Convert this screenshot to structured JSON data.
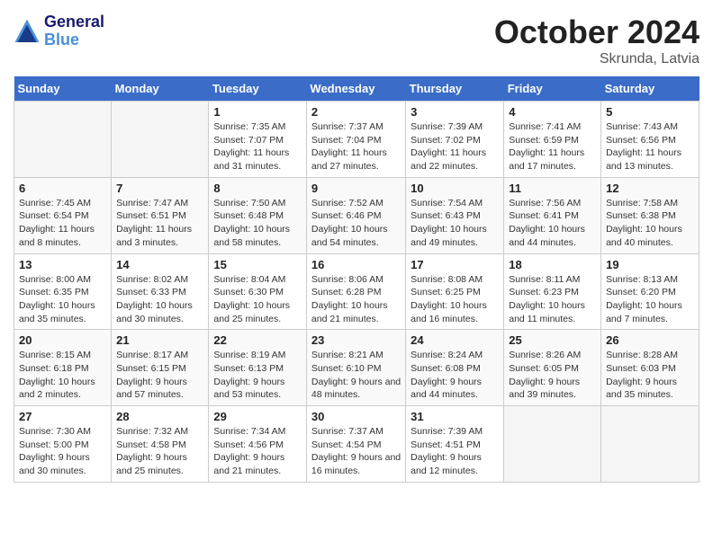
{
  "header": {
    "logo_line1": "General",
    "logo_line2": "Blue",
    "month": "October 2024",
    "location": "Skrunda, Latvia"
  },
  "weekdays": [
    "Sunday",
    "Monday",
    "Tuesday",
    "Wednesday",
    "Thursday",
    "Friday",
    "Saturday"
  ],
  "weeks": [
    [
      {
        "day": "",
        "info": ""
      },
      {
        "day": "",
        "info": ""
      },
      {
        "day": "1",
        "info": "Sunrise: 7:35 AM\nSunset: 7:07 PM\nDaylight: 11 hours and 31 minutes."
      },
      {
        "day": "2",
        "info": "Sunrise: 7:37 AM\nSunset: 7:04 PM\nDaylight: 11 hours and 27 minutes."
      },
      {
        "day": "3",
        "info": "Sunrise: 7:39 AM\nSunset: 7:02 PM\nDaylight: 11 hours and 22 minutes."
      },
      {
        "day": "4",
        "info": "Sunrise: 7:41 AM\nSunset: 6:59 PM\nDaylight: 11 hours and 17 minutes."
      },
      {
        "day": "5",
        "info": "Sunrise: 7:43 AM\nSunset: 6:56 PM\nDaylight: 11 hours and 13 minutes."
      }
    ],
    [
      {
        "day": "6",
        "info": "Sunrise: 7:45 AM\nSunset: 6:54 PM\nDaylight: 11 hours and 8 minutes."
      },
      {
        "day": "7",
        "info": "Sunrise: 7:47 AM\nSunset: 6:51 PM\nDaylight: 11 hours and 3 minutes."
      },
      {
        "day": "8",
        "info": "Sunrise: 7:50 AM\nSunset: 6:48 PM\nDaylight: 10 hours and 58 minutes."
      },
      {
        "day": "9",
        "info": "Sunrise: 7:52 AM\nSunset: 6:46 PM\nDaylight: 10 hours and 54 minutes."
      },
      {
        "day": "10",
        "info": "Sunrise: 7:54 AM\nSunset: 6:43 PM\nDaylight: 10 hours and 49 minutes."
      },
      {
        "day": "11",
        "info": "Sunrise: 7:56 AM\nSunset: 6:41 PM\nDaylight: 10 hours and 44 minutes."
      },
      {
        "day": "12",
        "info": "Sunrise: 7:58 AM\nSunset: 6:38 PM\nDaylight: 10 hours and 40 minutes."
      }
    ],
    [
      {
        "day": "13",
        "info": "Sunrise: 8:00 AM\nSunset: 6:35 PM\nDaylight: 10 hours and 35 minutes."
      },
      {
        "day": "14",
        "info": "Sunrise: 8:02 AM\nSunset: 6:33 PM\nDaylight: 10 hours and 30 minutes."
      },
      {
        "day": "15",
        "info": "Sunrise: 8:04 AM\nSunset: 6:30 PM\nDaylight: 10 hours and 25 minutes."
      },
      {
        "day": "16",
        "info": "Sunrise: 8:06 AM\nSunset: 6:28 PM\nDaylight: 10 hours and 21 minutes."
      },
      {
        "day": "17",
        "info": "Sunrise: 8:08 AM\nSunset: 6:25 PM\nDaylight: 10 hours and 16 minutes."
      },
      {
        "day": "18",
        "info": "Sunrise: 8:11 AM\nSunset: 6:23 PM\nDaylight: 10 hours and 11 minutes."
      },
      {
        "day": "19",
        "info": "Sunrise: 8:13 AM\nSunset: 6:20 PM\nDaylight: 10 hours and 7 minutes."
      }
    ],
    [
      {
        "day": "20",
        "info": "Sunrise: 8:15 AM\nSunset: 6:18 PM\nDaylight: 10 hours and 2 minutes."
      },
      {
        "day": "21",
        "info": "Sunrise: 8:17 AM\nSunset: 6:15 PM\nDaylight: 9 hours and 57 minutes."
      },
      {
        "day": "22",
        "info": "Sunrise: 8:19 AM\nSunset: 6:13 PM\nDaylight: 9 hours and 53 minutes."
      },
      {
        "day": "23",
        "info": "Sunrise: 8:21 AM\nSunset: 6:10 PM\nDaylight: 9 hours and 48 minutes."
      },
      {
        "day": "24",
        "info": "Sunrise: 8:24 AM\nSunset: 6:08 PM\nDaylight: 9 hours and 44 minutes."
      },
      {
        "day": "25",
        "info": "Sunrise: 8:26 AM\nSunset: 6:05 PM\nDaylight: 9 hours and 39 minutes."
      },
      {
        "day": "26",
        "info": "Sunrise: 8:28 AM\nSunset: 6:03 PM\nDaylight: 9 hours and 35 minutes."
      }
    ],
    [
      {
        "day": "27",
        "info": "Sunrise: 7:30 AM\nSunset: 5:00 PM\nDaylight: 9 hours and 30 minutes."
      },
      {
        "day": "28",
        "info": "Sunrise: 7:32 AM\nSunset: 4:58 PM\nDaylight: 9 hours and 25 minutes."
      },
      {
        "day": "29",
        "info": "Sunrise: 7:34 AM\nSunset: 4:56 PM\nDaylight: 9 hours and 21 minutes."
      },
      {
        "day": "30",
        "info": "Sunrise: 7:37 AM\nSunset: 4:54 PM\nDaylight: 9 hours and 16 minutes."
      },
      {
        "day": "31",
        "info": "Sunrise: 7:39 AM\nSunset: 4:51 PM\nDaylight: 9 hours and 12 minutes."
      },
      {
        "day": "",
        "info": ""
      },
      {
        "day": "",
        "info": ""
      }
    ]
  ]
}
